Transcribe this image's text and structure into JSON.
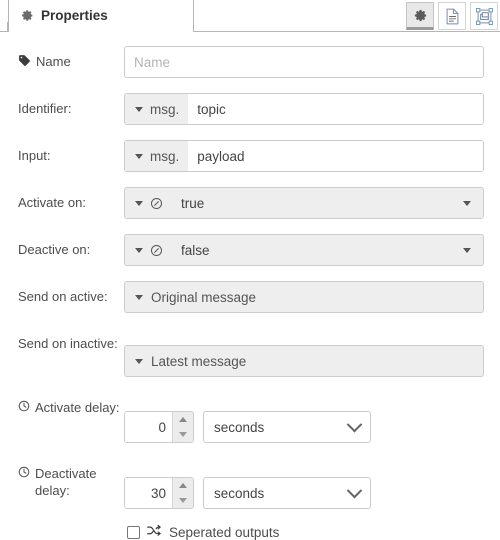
{
  "tab": {
    "label": "Properties",
    "icon": "gear-icon"
  },
  "tab_actions": [
    {
      "name": "properties-button",
      "icon": "gear-icon",
      "active": true
    },
    {
      "name": "description-button",
      "icon": "document-icon",
      "active": false
    },
    {
      "name": "appearance-button",
      "icon": "appearance-icon",
      "active": false
    }
  ],
  "form": {
    "name": {
      "label": "Name",
      "icon": "tag-icon",
      "value": "",
      "placeholder": "Name"
    },
    "identifier": {
      "label": "Identifier:",
      "type_prefix": "msg.",
      "value": "topic"
    },
    "input": {
      "label": "Input:",
      "type_prefix": "msg.",
      "value": "payload"
    },
    "activate_on": {
      "label": "Activate on:",
      "type_icon": "boolean-icon",
      "value": "true"
    },
    "deactive_on": {
      "label": "Deactive on:",
      "type_icon": "boolean-icon",
      "value": "false"
    },
    "send_on_active": {
      "label": "Send on active:",
      "value": "Original message"
    },
    "send_on_inactive": {
      "label": "Send on inactive:",
      "value": "Latest message"
    },
    "activate_delay": {
      "label": "Activate delay:",
      "icon": "clock-icon",
      "value": "0",
      "unit": "seconds"
    },
    "deactivate_delay": {
      "label": "Deactivate delay:",
      "icon": "clock-icon",
      "value": "30",
      "unit": "seconds"
    },
    "separated_outputs": {
      "label": "Seperated outputs",
      "icon": "shuffle-icon",
      "checked": false
    }
  },
  "colors": {
    "border": "#cccccc",
    "field_gray": "#eeeeee",
    "text": "#4d4d4d",
    "placeholder": "#b3b3b3",
    "active_btn": "#e8e8e8"
  }
}
